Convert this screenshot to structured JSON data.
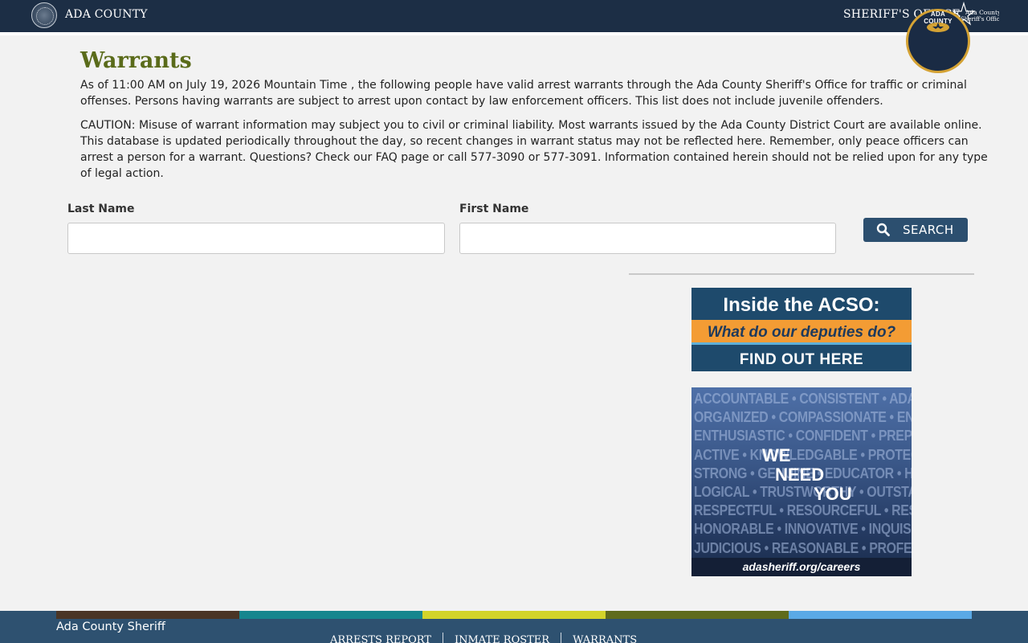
{
  "header": {
    "county_name": "ADA COUNTY",
    "office_name": "SHERIFF'S OFFICE",
    "logo_text_line1": "Ada County",
    "logo_text_line2": "Sheriff's Office"
  },
  "main": {
    "title": "Warrants",
    "intro": "As of 11:00 AM on July 19, 2026 Mountain Time , the following people have valid arrest warrants through the Ada County Sheriff's Office for traffic or criminal offenses. Persons having warrants are subject to arrest upon contact by law enforcement officers. This list does not include juvenile offenders.",
    "caution": "CAUTION: Misuse of warrant information may subject you to civil or criminal liability. Most warrants issued by the Ada County District Court are available online. This database is updated periodically throughout the day, so recent changes in warrant status may not be reflected here. Remember, only peace officers can arrest a person for a warrant. Questions? Check our FAQ page or call 577-3090 or 577-3091. Information contained herein should not be relied upon for any type of legal action."
  },
  "form": {
    "last_name_label": "Last Name",
    "last_name_value": "",
    "first_name_label": "First Name",
    "first_name_value": "",
    "search_label": "SEARCH"
  },
  "banners": {
    "acso": {
      "title": "Inside the ACSO:",
      "subtitle": "What do our deputies do?",
      "cta": "FIND OUT HERE"
    },
    "careers": {
      "words": [
        "ACCOUNTABLE • CONSISTENT • ADAPTABLE",
        "ORGANIZED • COMPASSIONATE • ENERGETIC",
        "ENTHUSIASTIC • CONFIDENT • PREPARED",
        "ACTIVE • KNOWLEDGABLE • PROTECTIVE",
        "STRONG • GENUINE • EDUCATOR • HONEST",
        "LOGICAL • TRUSTWORTHY • OUTSTANDING",
        "RESPECTFUL • RESOURCEFUL • RESILIENT",
        "HONORABLE • INNOVATIVE • INQUISITIVE",
        "JUDICIOUS • REASONABLE • PROFESSIONAL"
      ],
      "we": "WE",
      "need": "NEED",
      "you": "YOU",
      "url": "adasheriff.org/careers"
    }
  },
  "footer": {
    "title": "Ada County Sheriff",
    "links": [
      "ARRESTS REPORT",
      "INMATE ROSTER",
      "WARRANTS"
    ],
    "seal_text": "ADA COUNTY",
    "stripe_colors": [
      "#4a3526",
      "#16868e",
      "#d3d42a",
      "#5f6b1c",
      "#5aa9e6"
    ]
  },
  "colors": {
    "header_bg": "#1c2e45",
    "title_olive": "#5a6b1a",
    "button_bg": "#2c4f6f",
    "footer_bg": "#2e5170"
  }
}
